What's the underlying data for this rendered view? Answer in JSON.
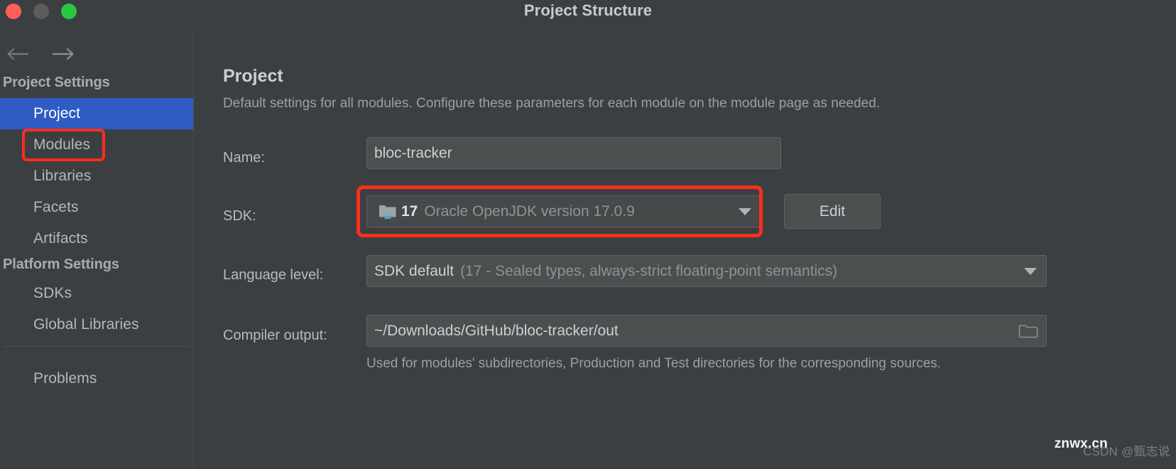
{
  "window": {
    "title": "Project Structure",
    "traffic_lights": [
      "close",
      "minimize",
      "zoom"
    ]
  },
  "sidebar": {
    "back_icon": "arrow-left-icon",
    "forward_icon": "arrow-right-icon",
    "groups": [
      {
        "title": "Project Settings",
        "items": [
          {
            "label": "Project",
            "selected": true
          },
          {
            "label": "Modules",
            "selected": false
          },
          {
            "label": "Libraries",
            "selected": false
          },
          {
            "label": "Facets",
            "selected": false
          },
          {
            "label": "Artifacts",
            "selected": false
          }
        ]
      },
      {
        "title": "Platform Settings",
        "items": [
          {
            "label": "SDKs",
            "selected": false
          },
          {
            "label": "Global Libraries",
            "selected": false
          }
        ]
      }
    ],
    "problems": {
      "label": "Problems"
    }
  },
  "main": {
    "title": "Project",
    "description": "Default settings for all modules. Configure these parameters for each module on the module page as needed.",
    "name": {
      "label": "Name:",
      "value": "bloc-tracker"
    },
    "sdk": {
      "label": "SDK:",
      "icon": "jdk-folder-icon",
      "version": "17",
      "description": "Oracle OpenJDK version 17.0.9",
      "caret_icon": "chevron-down-icon",
      "edit_label": "Edit"
    },
    "language_level": {
      "label": "Language level:",
      "value": "SDK default",
      "detail": "(17 - Sealed types, always-strict floating-point semantics)",
      "caret_icon": "chevron-down-icon"
    },
    "compiler_output": {
      "label": "Compiler output:",
      "value": "~/Downloads/GitHub/bloc-tracker/out",
      "browse_icon": "folder-icon",
      "hint": "Used for modules' subdirectories, Production and Test directories for the corresponding sources."
    }
  },
  "highlights": {
    "color": "#fc2e1c",
    "regions": [
      "sidebar-project-item",
      "sdk-combobox"
    ]
  },
  "watermark": {
    "main": "znwx.cn",
    "sub": "CSDN @甄志说"
  },
  "colors": {
    "background": "#3c3f41",
    "selection": "#2f5cc4",
    "field": "#45494a",
    "border": "#5e6364",
    "text": "#cdd0d2",
    "text_dim": "#9ba0a2",
    "accent_red": "#fc2e1c",
    "java_blue": "#44a7d8"
  }
}
